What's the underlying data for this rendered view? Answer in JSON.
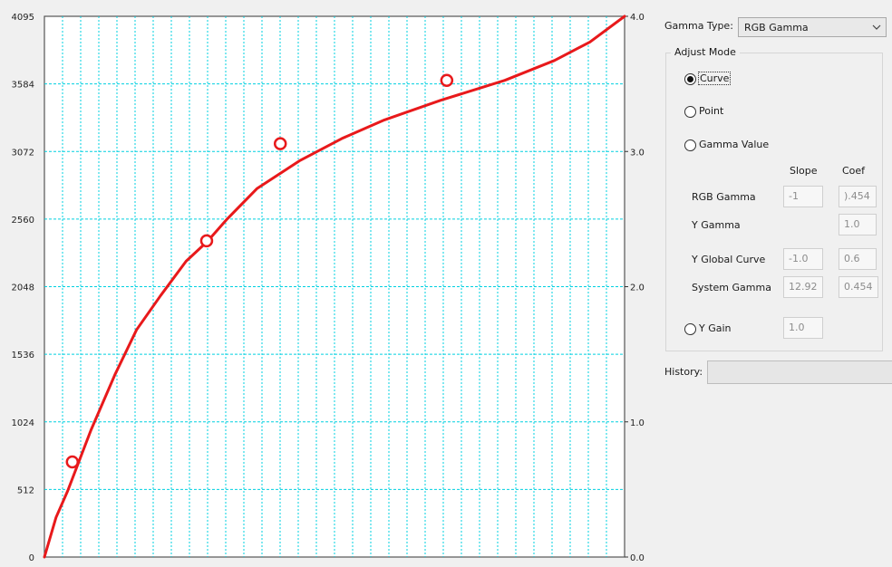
{
  "chart_data": {
    "type": "line",
    "title": "",
    "left_axis": {
      "ticks": [
        "0",
        "512",
        "1024",
        "1536",
        "2048",
        "2560",
        "3072",
        "3584",
        "4095"
      ],
      "range": [
        0,
        4095
      ]
    },
    "right_axis": {
      "ticks": [
        "0.0",
        "1.0",
        "2.0",
        "3.0",
        "4.0"
      ],
      "range": [
        0,
        4
      ]
    },
    "x_range": [
      0,
      4095
    ],
    "grid": true,
    "grid_color": "#00d0e0",
    "curve_color": "#e8191b",
    "series": [
      {
        "values": [
          [
            0,
            0
          ],
          [
            82,
            300
          ],
          [
            164,
            500
          ],
          [
            328,
            960
          ],
          [
            497,
            1380
          ],
          [
            650,
            1720
          ],
          [
            820,
            1980
          ],
          [
            1000,
            2240
          ],
          [
            1150,
            2390
          ],
          [
            1290,
            2560
          ],
          [
            1500,
            2790
          ],
          [
            1800,
            3000
          ],
          [
            2100,
            3170
          ],
          [
            2400,
            3310
          ],
          [
            2800,
            3460
          ],
          [
            3250,
            3610
          ],
          [
            3600,
            3760
          ],
          [
            3850,
            3900
          ],
          [
            4095,
            4095
          ]
        ]
      }
    ],
    "control_points": [
      [
        197,
        720
      ],
      [
        1145,
        2395
      ],
      [
        1665,
        3130
      ],
      [
        2840,
        3610
      ]
    ]
  },
  "panel": {
    "gamma_type_label": "Gamma Type:",
    "gamma_type_value": "RGB Gamma",
    "adjust_mode_title": "Adjust Mode",
    "options": {
      "curve": "Curve",
      "point": "Point",
      "gamma_value": "Gamma Value",
      "y_gain": "Y Gain"
    },
    "selected_option": "curve",
    "columns": {
      "slope": "Slope",
      "coef": "Coef"
    },
    "rows": [
      {
        "label": "RGB Gamma",
        "slope": "-1",
        "coef": ").454"
      },
      {
        "label": "Y Gamma",
        "slope": "",
        "coef": "1.0"
      },
      {
        "label": "Y Global Curve",
        "slope": "-1.0",
        "coef": "0.6"
      },
      {
        "label": "System Gamma",
        "slope": "12.92",
        "coef": "0.454"
      }
    ],
    "y_gain_value": "1.0",
    "history_label": "History:",
    "history_value": ""
  }
}
